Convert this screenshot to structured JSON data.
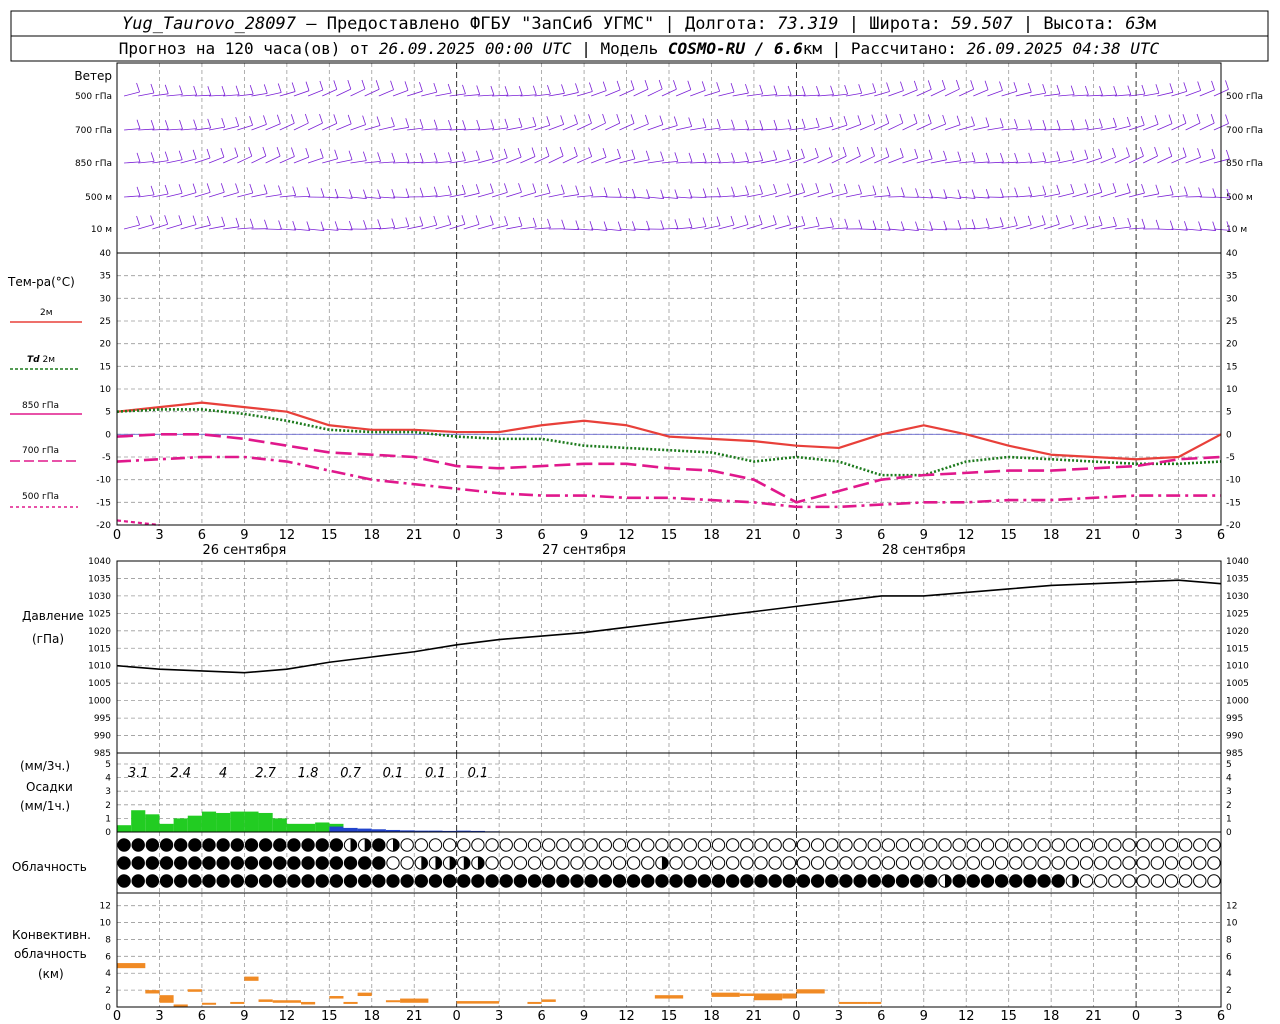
{
  "header": {
    "station": "Yug_Taurovo_28097",
    "provider": "– Предоставлено ФГБУ \"ЗапСиб УГМС\"",
    "lon_label": "Долгота:",
    "lon_value": "73.319",
    "lat_label": "Широта:",
    "lat_value": "59.507",
    "alt_label": "Высота:",
    "alt_value": "63",
    "alt_unit": "м",
    "forecast_prefix": "Прогноз на 120 часа(ов) от",
    "forecast_start": "26.09.2025 00:00 UTC",
    "model_label": "| Модель",
    "model_name": "COSMO-RU / 6.6",
    "model_unit": "км",
    "calc_label": "| Рассчитано:",
    "calc_time": "26.09.2025 04:38 UTC"
  },
  "labels": {
    "wind": "Ветер",
    "wind_levels": [
      "500 гПа",
      "700 гПа",
      "850 гПа",
      "500 м",
      "10 м"
    ],
    "temp_title": "Тем-ра(°С)",
    "t2m": "2м",
    "td_prefix": "Td",
    "td_suffix": "2м",
    "t850": "850 гПа",
    "t700": "700 гПа",
    "t500": "500 гПа",
    "pressure_title": "Давление",
    "pressure_unit": "(гПа)",
    "precip_unit3": "(мм/3ч.)",
    "precip_title": "Осадки",
    "precip_unit1": "(мм/1ч.)",
    "cloud_title": "Облачность",
    "conv_title1": "Конвективн.",
    "conv_title2": "облачность",
    "conv_unit": "(км)"
  },
  "days": [
    "26 сентября",
    "27 сентября",
    "28 сентября"
  ],
  "hour_ticks": [
    "0",
    "3",
    "6",
    "9",
    "12",
    "15",
    "18",
    "21",
    "0",
    "3",
    "6",
    "9",
    "12",
    "15",
    "18",
    "21",
    "0",
    "3",
    "6",
    "9",
    "12",
    "15",
    "18",
    "21",
    "0",
    "3",
    "6"
  ],
  "colors": {
    "t2m": "#e8403a",
    "td2m": "#1c7a1c",
    "upper": "#e0188c",
    "wind": "#7a1fd6",
    "rain": "#22cc22",
    "snow": "#2244cc",
    "conv": "#f08a24",
    "pressure": "#000000"
  },
  "chart_data": [
    {
      "type": "line",
      "panel": "temperature",
      "ylim": [
        -20,
        40
      ],
      "y_ticks": [
        40,
        35,
        30,
        25,
        20,
        15,
        10,
        5,
        0,
        -5,
        -10,
        -15,
        -20
      ],
      "x_hours": [
        0,
        3,
        6,
        9,
        12,
        15,
        18,
        21,
        24,
        27,
        30,
        33,
        36,
        39,
        42,
        45,
        48,
        51,
        54,
        57,
        60,
        63,
        66,
        69,
        72,
        75,
        78
      ],
      "series": [
        {
          "name": "2м",
          "values": [
            5,
            6,
            7,
            6,
            5,
            2,
            1,
            1,
            0.5,
            0.5,
            2,
            3,
            2,
            -0.5,
            -1,
            -1.5,
            -2.5,
            -3,
            0,
            2,
            0,
            -2.5,
            -4.5,
            -5,
            -5.5,
            -5,
            0
          ]
        },
        {
          "name": "Td 2м",
          "values": [
            5,
            5.5,
            5.5,
            4.5,
            3,
            1,
            0.5,
            0.5,
            -0.5,
            -1,
            -1,
            -2.5,
            -3,
            -3.5,
            -4,
            -6,
            -5,
            -6,
            -9,
            -9,
            -6,
            -5,
            -5.5,
            -6,
            -6.5,
            -6.5,
            -6
          ]
        },
        {
          "name": "850 гПа",
          "values": [
            -0.5,
            0,
            0,
            -1,
            -2.5,
            -4,
            -4.5,
            -5,
            -7,
            -7.5,
            -7,
            -6.5,
            -6.5,
            -7.5,
            -8,
            -10,
            -15,
            -12.5,
            -10,
            -9,
            -8.5,
            -8,
            -8,
            -7.5,
            -7,
            -5.5,
            -5
          ]
        },
        {
          "name": "700 гПа",
          "values": [
            -6,
            -5.5,
            -5,
            -5,
            -6,
            -8,
            -10,
            -11,
            -12,
            -13,
            -13.5,
            -13.5,
            -14,
            -14,
            -14.5,
            -15,
            -16,
            -16,
            -15.5,
            -15,
            -15,
            -14.5,
            -14.5,
            -14,
            -13.5,
            -13.5,
            -13.5
          ]
        },
        {
          "name": "500 гПа",
          "values": [
            -19,
            -20
          ]
        }
      ]
    },
    {
      "type": "line",
      "panel": "pressure",
      "ylim": [
        985,
        1040
      ],
      "y_ticks": [
        1040,
        1035,
        1030,
        1025,
        1020,
        1015,
        1010,
        1005,
        1000,
        995,
        990,
        985
      ],
      "x_hours": [
        0,
        3,
        6,
        9,
        12,
        15,
        18,
        21,
        24,
        27,
        30,
        33,
        36,
        39,
        42,
        45,
        48,
        51,
        54,
        57,
        60,
        63,
        66,
        69,
        72,
        75,
        78
      ],
      "series": [
        {
          "name": "Давление",
          "values": [
            1010,
            1009,
            1008.5,
            1008,
            1009,
            1011,
            1012.5,
            1014,
            1016,
            1017.5,
            1018.5,
            1019.5,
            1021,
            1022.5,
            1024,
            1025.5,
            1027,
            1028.5,
            1030,
            1030,
            1031,
            1032,
            1033,
            1033.5,
            1034,
            1034.5,
            1033.5
          ]
        }
      ]
    },
    {
      "type": "bar",
      "panel": "precipitation",
      "ylim": [
        0,
        5
      ],
      "y_ticks": [
        5,
        4,
        3,
        2,
        1,
        0
      ],
      "x_hours": [
        0,
        1,
        2,
        3,
        4,
        5,
        6,
        7,
        8,
        9,
        10,
        11,
        12,
        13,
        14,
        15,
        16,
        17,
        18,
        19,
        20,
        21,
        22,
        23,
        24,
        25,
        26
      ],
      "series": [
        {
          "name": "rain",
          "values": [
            0.5,
            1.6,
            1.3,
            0.6,
            1.0,
            1.2,
            1.5,
            1.4,
            1.5,
            1.5,
            1.4,
            1.0,
            0.6,
            0.6,
            0.7,
            0.6,
            0.2,
            0.1,
            0,
            0,
            0,
            0,
            0,
            0,
            0,
            0,
            0
          ]
        },
        {
          "name": "snow",
          "values": [
            0,
            0,
            0,
            0,
            0,
            0,
            0,
            0,
            0,
            0,
            0,
            0,
            0,
            0,
            0,
            0.4,
            0.3,
            0.25,
            0.2,
            0.15,
            0.12,
            0.1,
            0.1,
            0.08,
            0.1,
            0.08,
            0.05
          ]
        }
      ],
      "sums_3h": [
        "3.1",
        "2.4",
        "4",
        "2.7",
        "1.8",
        "0.7",
        "0.1",
        "0.1",
        "0.1"
      ]
    },
    {
      "type": "table",
      "panel": "cloudiness",
      "rows": [
        "ffffffffffffffffhHfhoooooooooooooooooooooooooooooooooooooooooooooooooooooooooooooooooooooooooooooh",
        "fffffffffffffffffffoohhhhhoooooooooooohoooooooooooooooooooooooooooooooooooooooooooooooooooooooooooh",
        "ffffffffffffffffffffffffffffffffffffffffffffffffffffffffffhffffffffhooooooooooooooooooooooooooooooo"
      ]
    },
    {
      "type": "bar",
      "panel": "convective_cloud",
      "ylim": [
        0,
        13
      ],
      "y_ticks": [
        12,
        10,
        8,
        6,
        4,
        2,
        0
      ],
      "series": [
        {
          "name": "conv",
          "segments": [
            [
              0,
              2,
              4.6,
              5.2
            ],
            [
              2,
              3,
              1.6,
              2.0
            ],
            [
              3,
              4,
              0.5,
              1.4
            ],
            [
              4,
              5,
              0.2,
              0.3
            ],
            [
              5,
              6,
              1.8,
              2.1
            ],
            [
              6,
              7,
              0.3,
              0.5
            ],
            [
              8,
              9,
              0.5,
              0.6
            ],
            [
              9,
              10,
              3.1,
              3.6
            ],
            [
              10,
              11,
              0.6,
              0.9
            ],
            [
              11,
              13,
              0.5,
              0.8
            ],
            [
              13,
              14,
              0.3,
              0.6
            ],
            [
              15,
              16,
              1.0,
              1.3
            ],
            [
              16,
              17,
              0.5,
              0.6
            ],
            [
              17,
              18,
              1.3,
              1.7
            ],
            [
              19,
              20,
              0.6,
              0.8
            ],
            [
              20,
              22,
              0.5,
              1.0
            ],
            [
              24,
              27,
              0.4,
              0.7
            ],
            [
              29,
              30,
              0.4,
              0.6
            ],
            [
              30,
              31,
              0.6,
              0.9
            ],
            [
              38,
              40,
              1.0,
              1.4
            ],
            [
              42,
              44,
              1.2,
              1.7
            ],
            [
              44,
              45,
              1.3,
              1.6
            ],
            [
              45,
              47,
              0.8,
              1.6
            ],
            [
              47,
              48,
              1.0,
              1.6
            ],
            [
              48,
              50,
              1.6,
              2.1
            ],
            [
              51,
              53,
              0.5,
              0.6
            ],
            [
              53,
              54,
              0.5,
              0.6
            ]
          ]
        }
      ]
    }
  ]
}
